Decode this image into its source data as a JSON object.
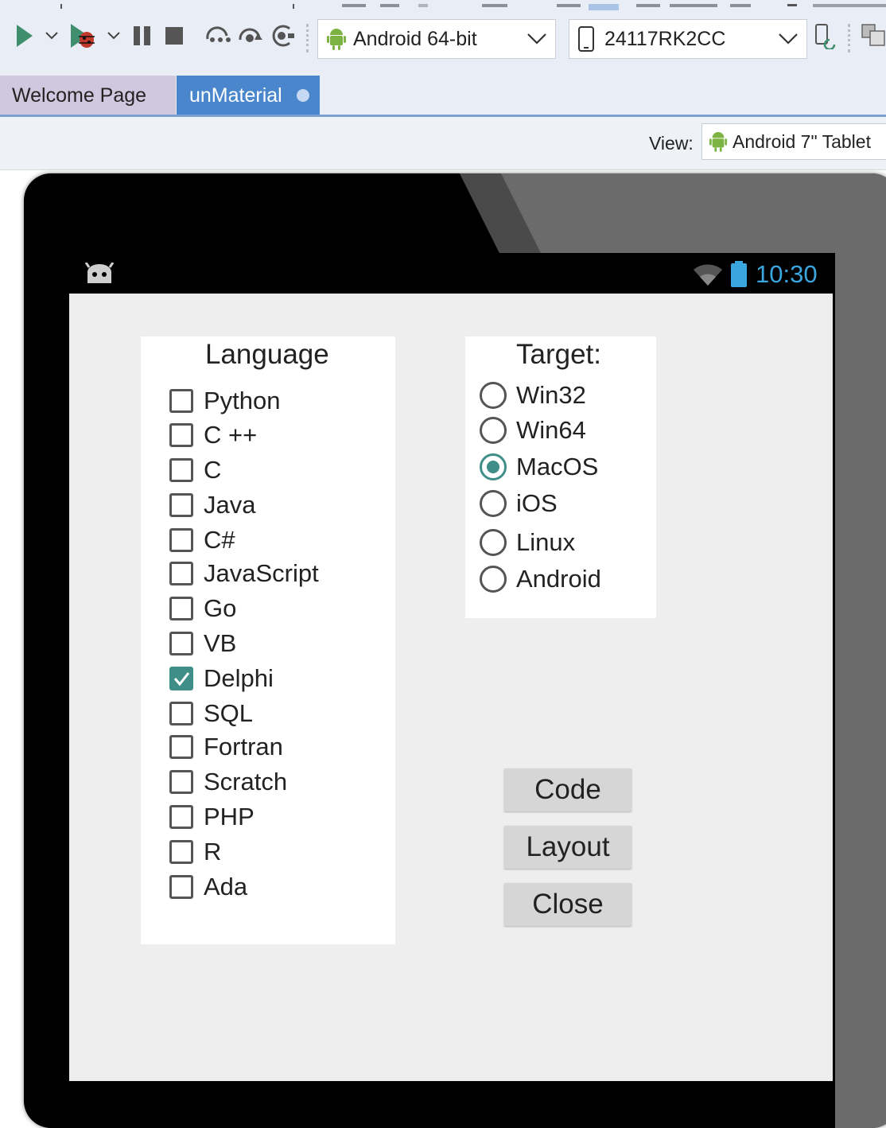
{
  "toolbar": {
    "platform_combo": {
      "label": "Android 64-bit",
      "icon": "android-icon"
    },
    "device_combo": {
      "label": "24117RK2CC",
      "icon": "phone-icon"
    }
  },
  "tabs": [
    {
      "label": "Welcome Page",
      "active": false
    },
    {
      "label": "unMaterial",
      "active": true,
      "modified": true
    }
  ],
  "view": {
    "label": "View:",
    "value": "Android 7\" Tablet"
  },
  "status_bar": {
    "time": "10:30"
  },
  "language_panel": {
    "title": "Language",
    "items": [
      {
        "label": "Python",
        "checked": false
      },
      {
        "label": "C ++",
        "checked": false
      },
      {
        "label": "C",
        "checked": false
      },
      {
        "label": "Java",
        "checked": false
      },
      {
        "label": "C#",
        "checked": false
      },
      {
        "label": "JavaScript",
        "checked": false
      },
      {
        "label": "Go",
        "checked": false
      },
      {
        "label": "VB",
        "checked": false
      },
      {
        "label": "Delphi",
        "checked": true
      },
      {
        "label": "SQL",
        "checked": false
      },
      {
        "label": "Fortran",
        "checked": false
      },
      {
        "label": "Scratch",
        "checked": false
      },
      {
        "label": "PHP",
        "checked": false
      },
      {
        "label": "R",
        "checked": false
      },
      {
        "label": "Ada",
        "checked": false
      }
    ]
  },
  "target_panel": {
    "title": "Target:",
    "options": [
      {
        "label": "Win32",
        "selected": false
      },
      {
        "label": "Win64",
        "selected": false
      },
      {
        "label": "MacOS",
        "selected": true
      },
      {
        "label": "iOS",
        "selected": false
      },
      {
        "label": "Linux",
        "selected": false
      },
      {
        "label": "Android",
        "selected": false
      }
    ]
  },
  "buttons": {
    "code": "Code",
    "layout": "Layout",
    "close": "Close"
  },
  "colors": {
    "accent": "#3f8f88",
    "active_tab": "#4a86cc",
    "inactive_tab": "#cfc8df",
    "clock": "#3aa6e0"
  }
}
